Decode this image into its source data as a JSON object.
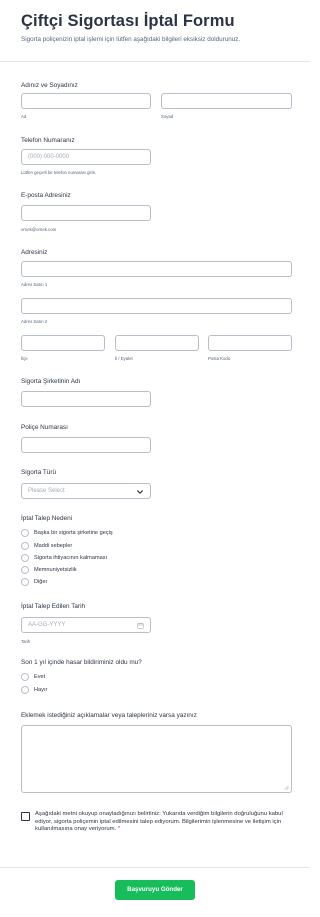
{
  "header": {
    "title": "Çiftçi Sigortası İptal Formu",
    "subtitle": "Sigorta poliçenizin iptal işlemi için lütfen aşağıdaki bilgileri eksiksiz doldurunuz."
  },
  "name": {
    "label": "Adınız ve Soyadınız",
    "first_sub": "Ad",
    "last_sub": "Soyad"
  },
  "phone": {
    "label": "Telefon Numaranız",
    "placeholder": "(000) 000-0000",
    "hint": "Lütfen geçerli bir telefon numarası girin."
  },
  "email": {
    "label": "E-posta Adresiniz",
    "hint": "ornek@ornek.com"
  },
  "address": {
    "label": "Adresiniz",
    "line1_sub": "Adres Satırı 1",
    "line2_sub": "Adres Satırı 2",
    "city_sub": "İlçe",
    "state_sub": "İl / Eyalet",
    "zip_sub": "Posta Kodu"
  },
  "company": {
    "label": "Sigorta Şirketinin Adı"
  },
  "policy": {
    "label": "Poliçe Numarası"
  },
  "insurance_type": {
    "label": "Sigorta Türü",
    "selected": "Please Select"
  },
  "cancel_reason": {
    "label": "İptal Talep Nedeni",
    "options": [
      "Başka bir sigorta şirketine geçiş",
      "Maddi sebepler",
      "Sigorta ihtiyacının kalmaması",
      "Memnuniyetsizlik",
      "Diğer"
    ]
  },
  "cancel_date": {
    "label": "İptal Talep Edilen Tarih",
    "placeholder": "AA-GG-YYYY",
    "hint": "Tarih"
  },
  "claims": {
    "label": "Son 1 yıl içinde hasar bildiriminiz oldu mu?",
    "options": [
      "Evet",
      "Hayır"
    ]
  },
  "notes": {
    "label": "Eklemek istediğiniz açıklamalar veya talepleriniz varsa yazınız"
  },
  "consent": {
    "text": "Aşağıdaki metni okuyup onayladığınızı belirtiniz: Yukarıda verdiğim bilgilerin doğruluğunu kabul ediyor, sigorta poliçemin iptal edilmesini talep ediyorum. Bilgilerimin işlenmesine ve iletişim için kullanılmasına onay veriyorum.",
    "required_mark": "*"
  },
  "submit": {
    "label": "Başvuruyu Gönder"
  },
  "icons": {
    "select_arrow": "chevron-down-icon",
    "date_picker": "calendar-icon",
    "resize": "resize-grip-icon"
  },
  "colors": {
    "submit": "#18bd5b",
    "required": "#f23a3c",
    "text": "#2c3345",
    "border": "#b8bdc9"
  }
}
